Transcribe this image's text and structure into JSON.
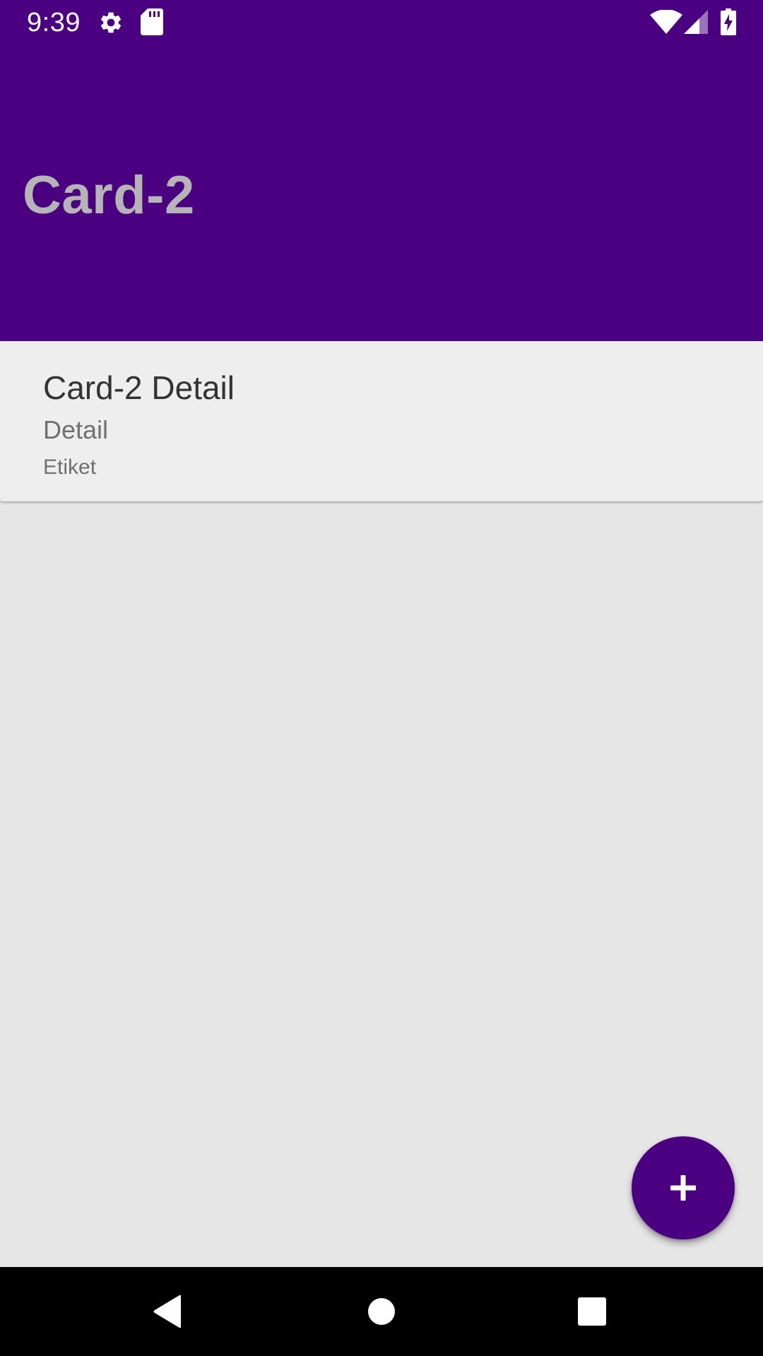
{
  "status_bar": {
    "time": "9:39",
    "icons_left": [
      "gear-icon",
      "sd-card-icon"
    ],
    "icons_right": [
      "wifi-icon",
      "cell-signal-icon",
      "battery-charging-icon"
    ]
  },
  "app_bar": {
    "title": "Card-2",
    "background_color": "#4b0082",
    "title_color": "#b5b5b5"
  },
  "card": {
    "title": "Card-2 Detail",
    "subtitle": "Detail",
    "label": "Etiket"
  },
  "fab": {
    "icon": "plus-icon",
    "color": "#4b0082"
  },
  "nav_bar": {
    "buttons": [
      "back-icon",
      "home-icon",
      "recents-icon"
    ]
  }
}
